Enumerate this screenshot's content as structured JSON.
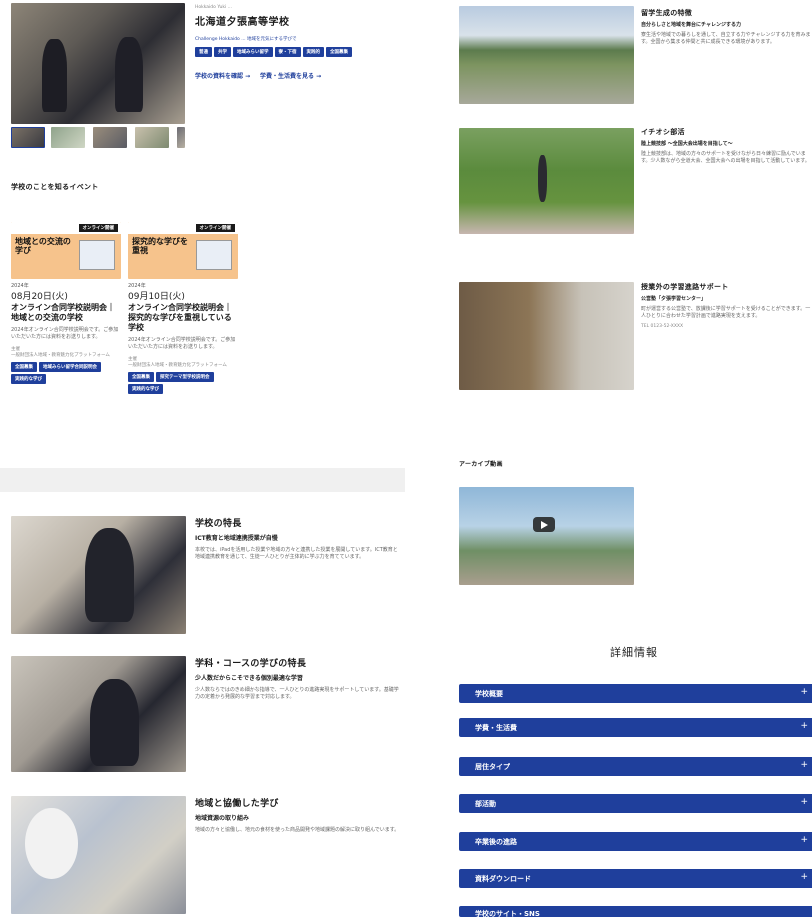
{
  "school": {
    "kicker": "Hokkaido Yuki ...",
    "name": "北海道夕張高等学校",
    "catch": "Challenge Hokkaido ... 地域を元気にする学びで",
    "tags": [
      "普通",
      "共学",
      "地域みらい留学",
      "寮・下宿",
      "実践的",
      "全国募集"
    ],
    "links": [
      "学校の資料を確認 →",
      "学費・生活費を見る →"
    ]
  },
  "events_heading": "学校のことを知るイベント",
  "events": [
    {
      "badge": "オンライン開催",
      "image_text": "地域との交流の学び",
      "year": "2024年",
      "date": "08月20日(火)",
      "title": "オンライン合同学校説明会｜地域との交流の学校",
      "desc": "2024年オンライン合同学校説明会です。ご参加いただいた方には資料をお送りします。",
      "org_label": "主催",
      "org": "一般財団法人地域・教育魅力化プラットフォーム",
      "tags": [
        "全国募集",
        "地域みらい留学合同説明会",
        "実践的な学び"
      ]
    },
    {
      "badge": "オンライン開催",
      "image_text": "探究的な学びを重視",
      "year": "2024年",
      "date": "09月10日(火)",
      "title": "オンライン合同学校説明会｜探究的な学びを重視している学校",
      "desc": "2024年オンライン合同学校説明会です。ご参加いただいた方には資料をお送りします。",
      "org_label": "主催",
      "org": "一般財団法人地域・教育魅力化プラットフォーム",
      "tags": [
        "全国募集",
        "探究テーマ型学校説明会",
        "実践的な学び"
      ]
    }
  ],
  "features": [
    {
      "title": "学校の特長",
      "sub": "ICT教育と地域連携授業が自慢",
      "text": "本校では、iPadを活用した授業や地域の方々と連携した授業を展開しています。ICT教育と地域連携教育を通じて、生徒一人ひとりが主体的に学ぶ力を育てています。"
    },
    {
      "title": "学科・コースの学びの特長",
      "sub": "少人数だからこそできる個別最適な学習",
      "text": "少人数ならではのきめ細かな指導で、一人ひとりの進路実現をサポートしています。基礎学力の定着から発展的な学習まで対応します。"
    },
    {
      "title": "地域と協働した学び",
      "sub": "地域資源の取り組み",
      "text": "地域の方々と協働し、地元の食材を使った商品開発や地域課題の解決に取り組んでいます。"
    }
  ],
  "right_features": [
    {
      "title": "留学生成の特徴",
      "sub": "自分らしさと地域を舞台にチャレンジする力",
      "text": "寮生活や地域での暮らしを通して、自立する力やチャレンジする力を育みます。全国から集まる仲間と共に成長できる環境があります。"
    },
    {
      "title": "イチオシ部活",
      "sub": "陸上競技部 〜全国大会出場を目指して〜",
      "text": "陸上競技部は、地域の方々のサポートを受けながら日々練習に励んでいます。少人数ながら全道大会、全国大会への出場を目指して活動しています。"
    },
    {
      "title": "授業外の学習進路サポート",
      "sub": "公営塾「夕張学習センター」",
      "text": "町が運営する公営塾で、放課後に学習サポートを受けることができます。一人ひとりに合わせた学習計画で進路実現を支えます。",
      "contact": "TEL 0123-52-XXXX"
    }
  ],
  "archive_heading": "アーカイブ動画",
  "details_heading": "詳細情報",
  "accordion": [
    "学校概要",
    "学費・生活費",
    "居住タイプ",
    "部活動",
    "卒業後の進路",
    "資料ダウンロード",
    "学校のサイト・SNS"
  ],
  "icons": {
    "accordion_toggle": "plus-icon",
    "video_play": "play-icon"
  },
  "colors": {
    "accent": "#1f3f9c"
  }
}
